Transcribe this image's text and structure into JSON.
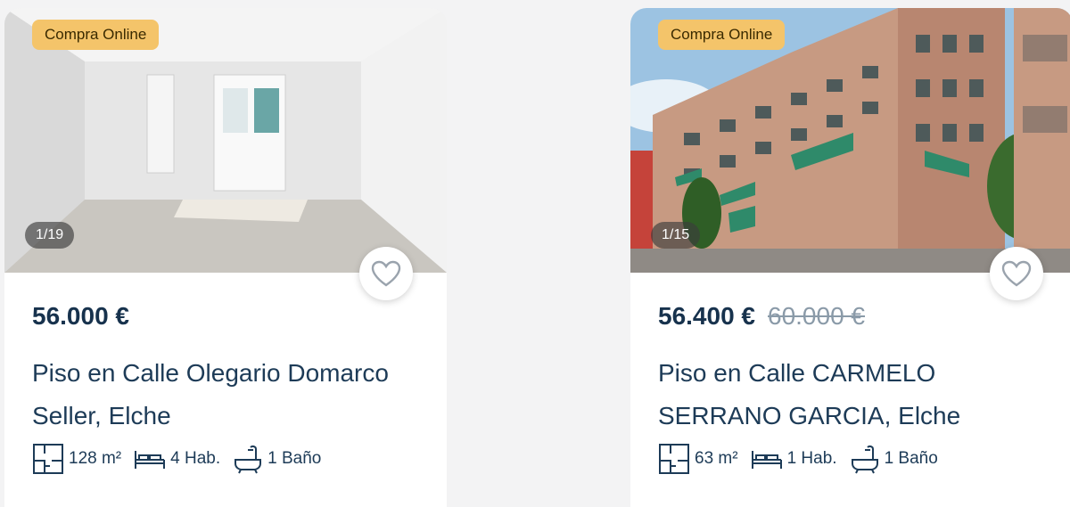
{
  "listings": [
    {
      "badge": "Compra Online",
      "photo_counter": "1/19",
      "price": "56.000 €",
      "old_price": "",
      "title": "Piso en Calle Olegario Domarco Seller, Elche",
      "area": "128 m²",
      "rooms": "4 Hab.",
      "baths": "1 Baño",
      "photo_desc": "empty-apartment-room"
    },
    {
      "badge": "Compra Online",
      "photo_counter": "1/15",
      "price": "56.400 €",
      "old_price": "60.000 €",
      "title": "Piso en Calle CARMELO SERRANO GARCIA, Elche",
      "area": "63 m²",
      "rooms": "1 Hab.",
      "baths": "1 Baño",
      "photo_desc": "apartment-building-exterior"
    }
  ],
  "icons": {
    "favorite": "heart-icon",
    "area": "floorplan-icon",
    "rooms": "bed-icon",
    "baths": "bathtub-icon"
  },
  "colors": {
    "badge_bg": "#f4c46a",
    "text_primary": "#17324d",
    "text_strikethrough": "#8a9aa8"
  }
}
